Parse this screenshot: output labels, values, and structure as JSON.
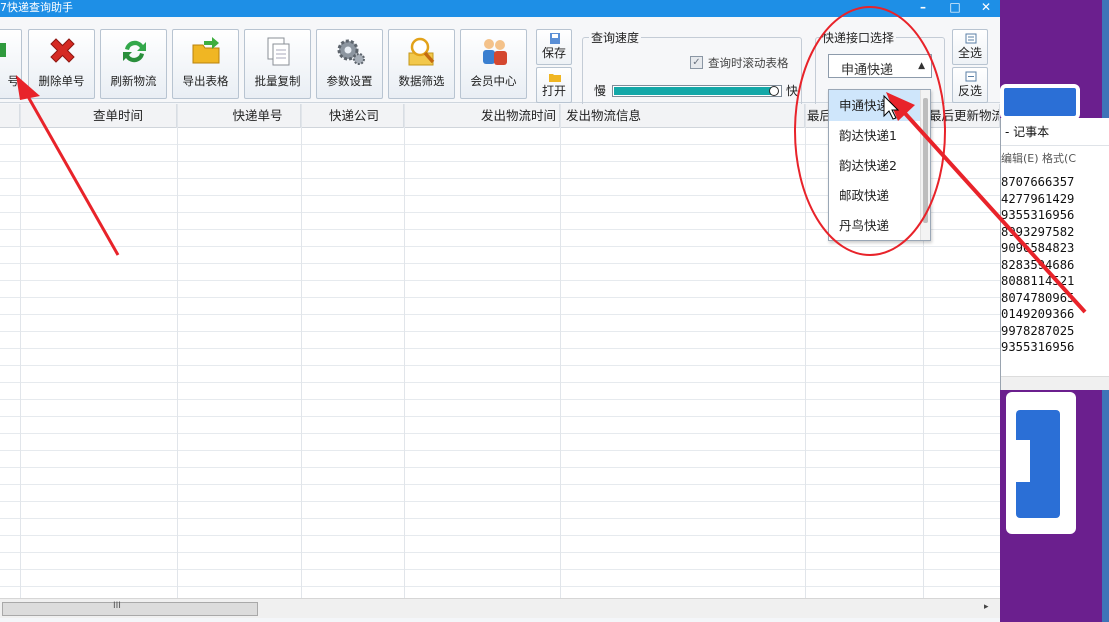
{
  "app": {
    "title": "7快递查询助手",
    "window_controls": {
      "minimize": "–",
      "maximize": "□",
      "close": "✕"
    }
  },
  "toolbar": {
    "buttons": [
      {
        "label": "号",
        "icon": "add-number-icon"
      },
      {
        "label": "删除单号",
        "icon": "delete-icon"
      },
      {
        "label": "刷新物流",
        "icon": "refresh-icon"
      },
      {
        "label": "导出表格",
        "icon": "export-folder-icon"
      },
      {
        "label": "批量复制",
        "icon": "copy-icon"
      },
      {
        "label": "参数设置",
        "icon": "gear-icon"
      },
      {
        "label": "数据筛选",
        "icon": "filter-search-icon"
      },
      {
        "label": "会员中心",
        "icon": "members-icon"
      }
    ],
    "save_label": "保存",
    "open_label": "打开",
    "select_all_label": "全选",
    "invert_label": "反选"
  },
  "speed": {
    "group_title": "查询速度",
    "scroll_checkbox_label": "查询时滚动表格",
    "scroll_checked": true,
    "slow_label": "慢",
    "fast_label": "快",
    "level": 1.0
  },
  "api": {
    "group_title": "快递接口选择",
    "selected": "申通快递",
    "options": [
      "申通快递",
      "韵达快递1",
      "韵达快递2",
      "邮政快递",
      "丹鸟快递"
    ],
    "highlighted_index": 0
  },
  "table": {
    "columns": [
      "查单时间",
      "快递单号",
      "快递公司",
      "发出物流时间",
      "发出物流信息",
      "最后",
      "最后更新物流"
    ]
  },
  "scrollbar": {
    "grip": "III",
    "right_arrow": "▸"
  },
  "notepad": {
    "title": "- 记事本",
    "menu": "编辑(E)  格式(C",
    "lines": [
      "8707666357",
      "4277961429",
      "9355316956",
      "8993297582",
      "9096584823",
      "8283594686",
      "8088114521",
      "8074780965",
      "0149209366",
      "9978287025",
      "9355316956"
    ]
  },
  "colors": {
    "title_bar": "#1e8fe6",
    "slider_fill": "#14a8a8",
    "annotation_red": "#e8232a",
    "dropdown_highlight": "#cfe6fb",
    "desktop_purple": "#6b1f8e"
  }
}
